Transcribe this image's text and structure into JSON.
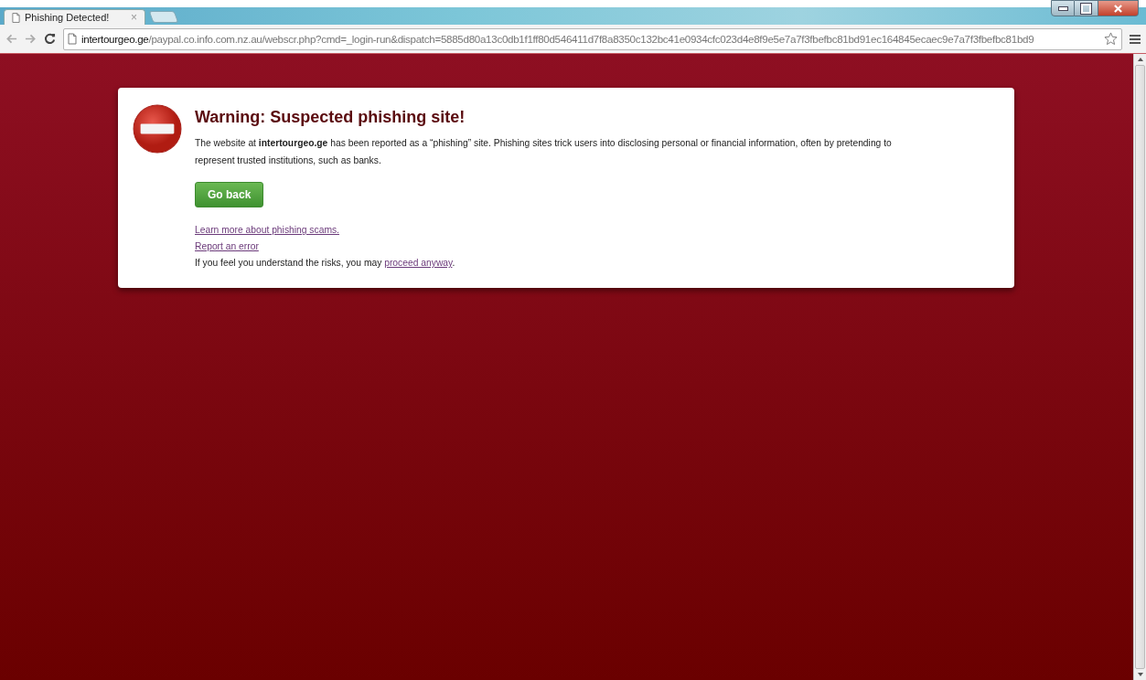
{
  "window": {
    "tabs": [
      {
        "label": "Phishing Detected!",
        "selected": true,
        "close": "×"
      }
    ]
  },
  "address_bar": {
    "host": "intertourgeo.ge",
    "path": "/paypal.co.info.com.nz.au/webscr.php?cmd=_login-run&dispatch=5885d80a13c0db1f1ff80d546411d7f8a8350c132bc41e0934cfc023d4e8f9e5e7a7f3fbefbc81bd91ec164845ecaec9e7a7f3fbefbc81bd9"
  },
  "warning": {
    "title": "Warning: Suspected phishing site!",
    "message": "The website at **intertourgeo.ge** has been reported as a “phishing” site. Phishing sites trick users into disclosing personal or financial information, often by pretending to represent trusted institutions, such as banks.",
    "button": "Go back",
    "links": [
      "Learn more about phishing scams.",
      "Report an error"
    ],
    "risk_text": "If you feel you understand the risks, you may",
    "risk_link": "proceed anyway",
    "risk_end": "."
  }
}
